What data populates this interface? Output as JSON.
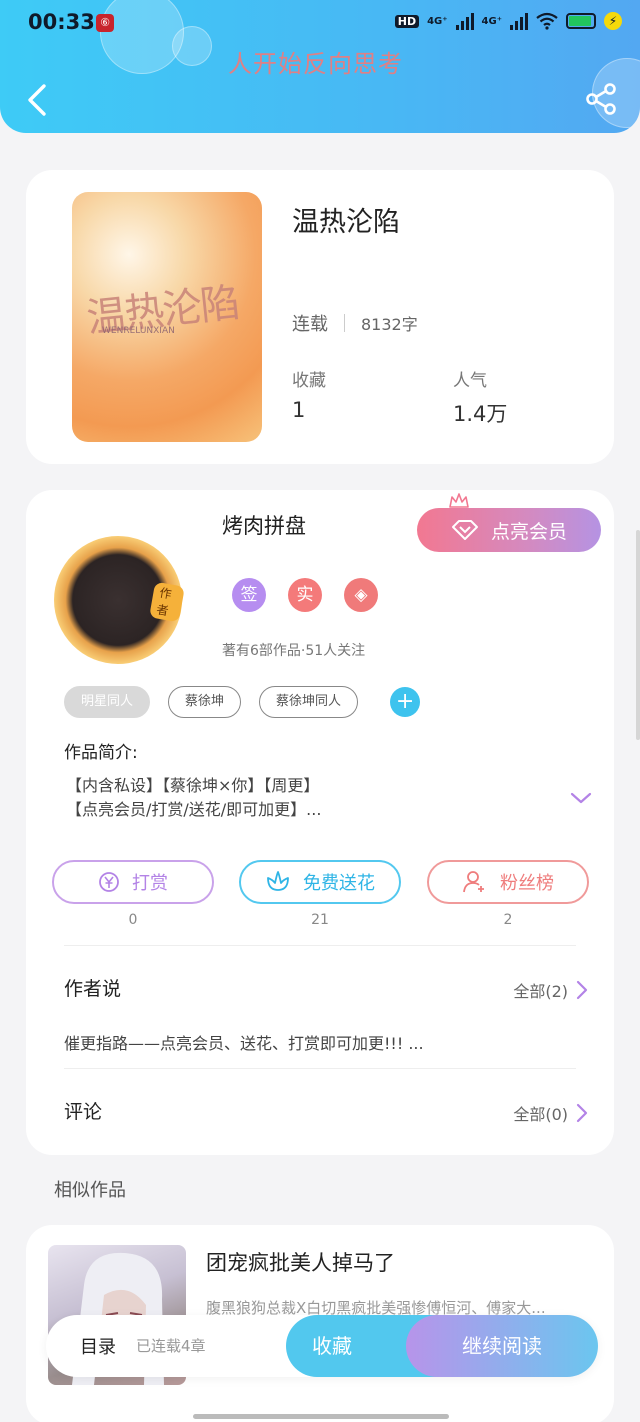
{
  "status_bar": {
    "time": "00:33",
    "app_badge": "⑥",
    "hd": "HD",
    "net1": "4G⁺",
    "net2": "4G⁺"
  },
  "header": {
    "watermark": "人开始反向思考"
  },
  "book": {
    "title": "温热沦陷",
    "cover_title": "温热沦陷",
    "cover_subtitle": "WENRELUNXIAN",
    "status": "连载",
    "word_count": "8132字",
    "collect_label": "收藏",
    "collect_value": "1",
    "popularity_label": "人气",
    "popularity_value": "1.4万"
  },
  "author": {
    "name": "烤肉拼盘",
    "avatar_tag": "作者",
    "member_button": "点亮会员",
    "badges": [
      "签",
      "实",
      "◈"
    ],
    "meta": "著有6部作品·51人关注"
  },
  "tags": [
    "明星同人",
    "蔡徐坤",
    "蔡徐坤同人"
  ],
  "intro": {
    "label": "作品简介:",
    "line1": "【内含私设】【蔡徐坤×你】【周更】",
    "line2": "【点亮会员/打赏/送花/即可加更】..."
  },
  "actions": {
    "reward": {
      "label": "打赏",
      "count": "0"
    },
    "flower": {
      "label": "免费送花",
      "count": "21"
    },
    "fans": {
      "label": "粉丝榜",
      "count": "2"
    }
  },
  "author_says": {
    "title": "作者说",
    "more": "全部(2)",
    "text": "催更指路——点亮会员、送花、打赏即可加更!!! ..."
  },
  "comments": {
    "title": "评论",
    "more": "全部(0)"
  },
  "similar": {
    "label": "相似作品",
    "title": "团宠疯批美人掉马了",
    "desc": "腹黑狼狗总裁X白切黑疯批美强惨傅恒河、傅家大..."
  },
  "bottom_bar": {
    "toc": "目录",
    "chapters": "已连载4章",
    "collect": "收藏",
    "continue": "继续阅读"
  },
  "colors": {
    "header_start": "#3ecbf6",
    "header_end": "#53a8f2",
    "member": "#f27891",
    "reward": "#b383e6",
    "flower": "#2fb5e6",
    "fans": "#ef7d7d",
    "accent_blue": "#52c8ee"
  }
}
